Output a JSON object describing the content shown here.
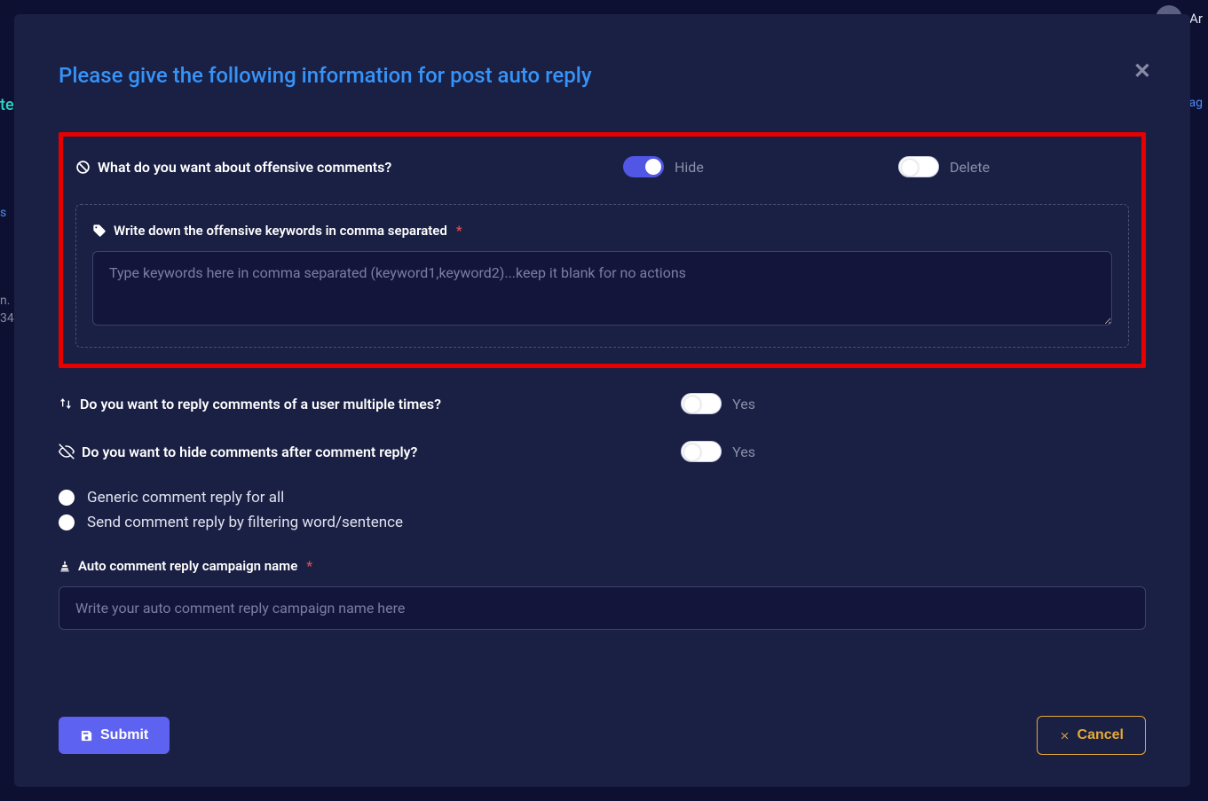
{
  "background": {
    "left_partial_1": "te",
    "left_partial_2": "s",
    "left_partial_3": "n.",
    "left_partial_4": "34",
    "right_partial_1": "Ar",
    "right_partial_2": "ag"
  },
  "modal": {
    "title": "Please give the following information for post auto reply",
    "offensive": {
      "question": "What do you want about offensive comments?",
      "hide_label": "Hide",
      "delete_label": "Delete",
      "keywords_label": "Write down the offensive keywords in comma separated",
      "keywords_placeholder": "Type keywords here in comma separated (keyword1,keyword2)...keep it blank for no actions"
    },
    "multi_reply": {
      "question": "Do you want to reply comments of a user multiple times?",
      "toggle_label": "Yes"
    },
    "hide_after": {
      "question": "Do you want to hide comments after comment reply?",
      "toggle_label": "Yes"
    },
    "reply_mode": {
      "generic": "Generic comment reply for all",
      "filter": "Send comment reply by filtering word/sentence"
    },
    "campaign": {
      "label": "Auto comment reply campaign name",
      "placeholder": "Write your auto comment reply campaign name here"
    },
    "buttons": {
      "submit": "Submit",
      "cancel": "Cancel"
    }
  }
}
